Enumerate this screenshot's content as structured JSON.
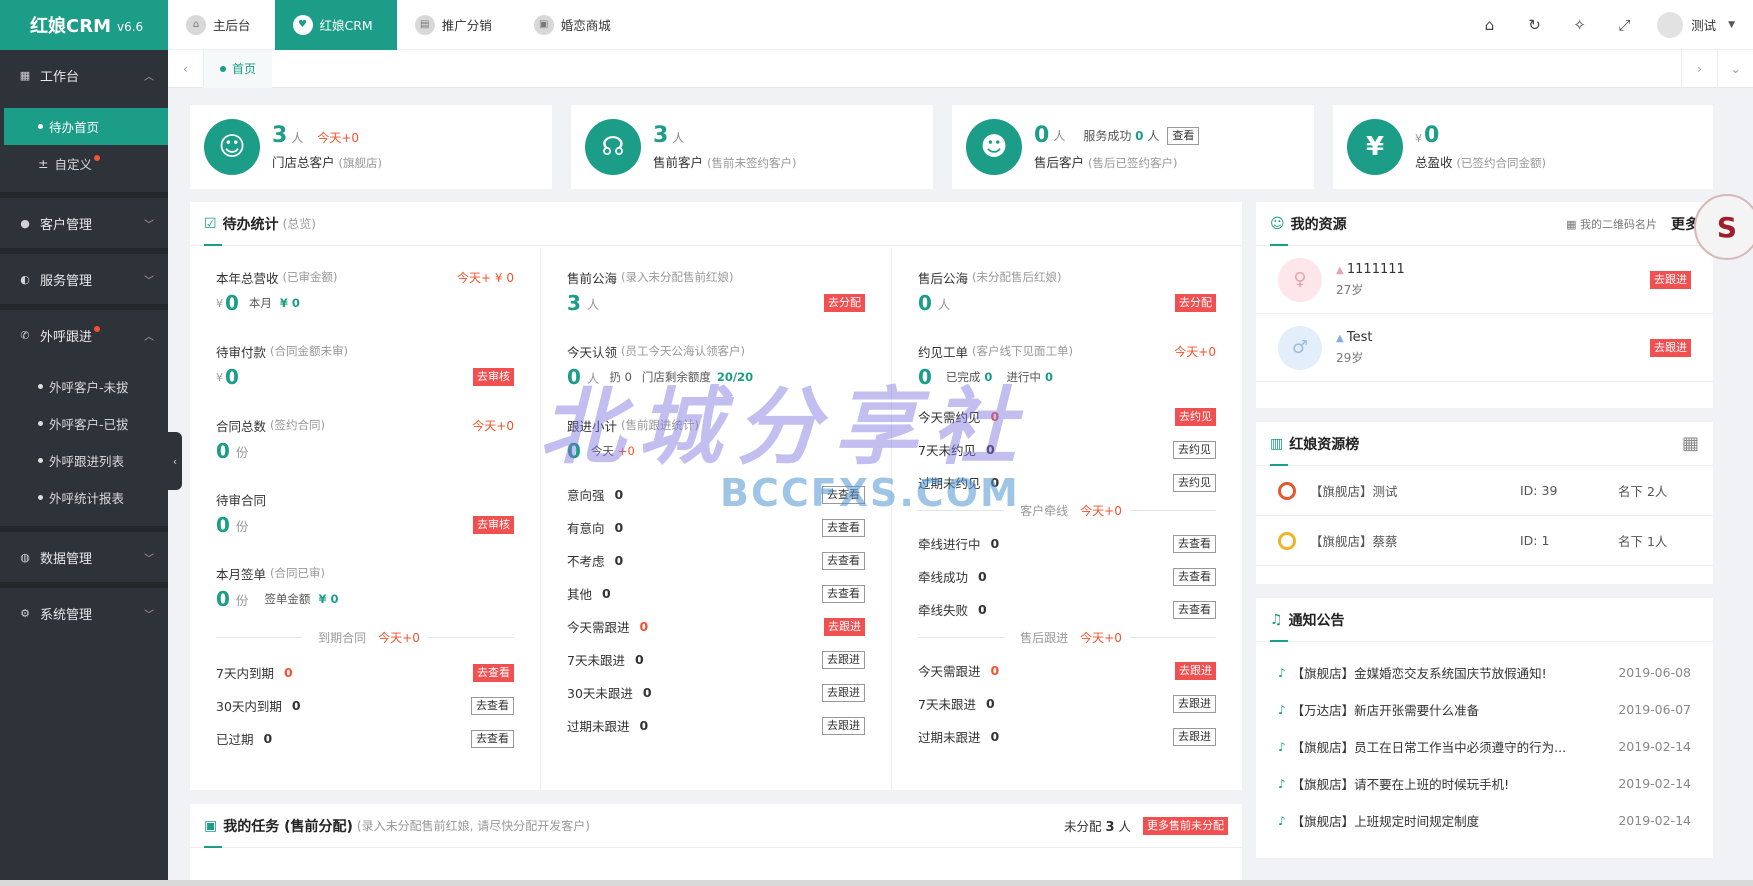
{
  "app": {
    "name": "红娘CRM",
    "version": "v6.6"
  },
  "sidebar": {
    "groups": [
      {
        "label": "工作台",
        "icon": "grid-icon",
        "expanded": true,
        "items": [
          {
            "label": "待办首页",
            "active": true
          },
          {
            "label": "自定义",
            "badge": true
          }
        ]
      },
      {
        "label": "客户管理",
        "icon": "user-icon",
        "expanded": false
      },
      {
        "label": "服务管理",
        "icon": "service-icon",
        "expanded": false
      },
      {
        "label": "外呼跟进",
        "icon": "phone-icon",
        "expanded": true,
        "badge": true,
        "items": [
          {
            "label": "外呼客户-未拔"
          },
          {
            "label": "外呼客户-已拔"
          },
          {
            "label": "外呼跟进列表"
          },
          {
            "label": "外呼统计报表"
          }
        ]
      },
      {
        "label": "数据管理",
        "icon": "data-icon",
        "expanded": false
      },
      {
        "label": "系统管理",
        "icon": "gear-icon",
        "expanded": false
      }
    ]
  },
  "topbar": {
    "tabs": [
      {
        "label": "主后台"
      },
      {
        "label": "红娘CRM",
        "active": true
      },
      {
        "label": "推广分销"
      },
      {
        "label": "婚恋商城"
      }
    ],
    "user": "测试"
  },
  "tabsbar": {
    "home": "首页"
  },
  "stats": [
    {
      "num": "3",
      "unit": "人",
      "today": "今天+0",
      "label": "门店总客户",
      "sub": "(旗舰店)",
      "icon": "customers-icon"
    },
    {
      "num": "3",
      "unit": "人",
      "label": "售前客户",
      "sub": "(售前未签约客户)",
      "icon": "headset-icon"
    },
    {
      "num": "0",
      "unit": "人",
      "svc_label": "服务成功",
      "svc_num": "0",
      "svc_unit": "人",
      "svc_btn": "查看",
      "label": "售后客户",
      "sub": "(售后已签约客户)",
      "icon": "agent-icon"
    },
    {
      "cur": "¥",
      "num": "0",
      "label": "总盈收",
      "sub": "(已签约合同金额)",
      "icon": "yen-icon"
    }
  ],
  "todo": {
    "title": "待办统计",
    "sub": "(总览)",
    "col1": {
      "annual_label": "本年总营收",
      "annual_sub": "(已审金额)",
      "annual_today": "今天+ ¥ 0",
      "annual_val": "0",
      "month_label": "本月",
      "month_val": "¥ 0",
      "pay_label": "待审付款",
      "pay_sub": "(合同金额未审)",
      "pay_val": "0",
      "pay_btn": "去审核",
      "contract_label": "合同总数",
      "contract_sub": "(签约合同)",
      "contract_today": "今天+0",
      "contract_val": "0",
      "contract_unit": "份",
      "pending_label": "待审合同",
      "pending_val": "0",
      "pending_unit": "份",
      "pending_btn": "去审核",
      "month_sign_label": "本月签单",
      "month_sign_sub": "(合同已审)",
      "month_sign_val": "0",
      "month_sign_unit": "份",
      "sign_amt_label": "签单金额",
      "sign_amt_val": "¥ 0",
      "expire_title": "到期合同",
      "expire_today": "今天+0",
      "expire_rows": [
        {
          "label": "7天内到期",
          "val": "0",
          "btn": "去查看",
          "hot": true
        },
        {
          "label": "30天内到期",
          "val": "0",
          "btn": "去查看"
        },
        {
          "label": "已过期",
          "val": "0",
          "btn": "去查看"
        }
      ]
    },
    "col2": {
      "pool_label": "售前公海",
      "pool_sub": "(录入未分配售前红娘)",
      "pool_val": "3",
      "pool_unit": "人",
      "pool_btn": "去分配",
      "claim_label": "今天认领",
      "claim_sub": "(员工今天公海认领客户)",
      "claim_val": "0",
      "claim_unit": "人",
      "claim_x": "扔 0",
      "claim_quota_label": "门店剩余额度",
      "claim_quota": "20/20",
      "follow_label": "跟进小计",
      "follow_sub": "(售前跟进统计)",
      "follow_val": "0",
      "follow_today": "今天",
      "follow_today_val": "+0",
      "rows": [
        {
          "label": "意向强",
          "val": "0",
          "btn": "去查看"
        },
        {
          "label": "有意向",
          "val": "0",
          "btn": "去查看"
        },
        {
          "label": "不考虑",
          "val": "0",
          "btn": "去查看"
        },
        {
          "label": "其他",
          "val": "0",
          "btn": "去查看"
        },
        {
          "label": "今天需跟进",
          "val": "0",
          "btn": "去跟进",
          "hot": true
        },
        {
          "label": "7天未跟进",
          "val": "0",
          "btn": "去跟进"
        },
        {
          "label": "30天未跟进",
          "val": "0",
          "btn": "去跟进"
        },
        {
          "label": "过期未跟进",
          "val": "0",
          "btn": "去跟进"
        }
      ]
    },
    "col3": {
      "pool_label": "售后公海",
      "pool_sub": "(未分配售后红娘)",
      "pool_val": "0",
      "pool_unit": "人",
      "pool_btn": "去分配",
      "meet_label": "约见工单",
      "meet_sub": "(客户线下见面工单)",
      "meet_today": "今天+0",
      "meet_val": "0",
      "done_label": "已完成",
      "done_val": "0",
      "going_label": "进行中",
      "going_val": "0",
      "meet_rows": [
        {
          "label": "今天需约见",
          "val": "0",
          "btn": "去约见",
          "hot": true
        },
        {
          "label": "7天未约见",
          "val": "0",
          "btn": "去约见"
        },
        {
          "label": "过期未约见",
          "val": "0",
          "btn": "去约见"
        }
      ],
      "line_title": "客户牵线",
      "line_today": "今天+0",
      "line_rows": [
        {
          "label": "牵线进行中",
          "val": "0",
          "btn": "去查看"
        },
        {
          "label": "牵线成功",
          "val": "0",
          "btn": "去查看"
        },
        {
          "label": "牵线失败",
          "val": "0",
          "btn": "去查看"
        }
      ],
      "after_title": "售后跟进",
      "after_today": "今天+0",
      "after_rows": [
        {
          "label": "今天需跟进",
          "val": "0",
          "btn": "去跟进",
          "hot": true
        },
        {
          "label": "7天未跟进",
          "val": "0",
          "btn": "去跟进"
        },
        {
          "label": "过期未跟进",
          "val": "0",
          "btn": "去跟进"
        }
      ]
    }
  },
  "tasks": {
    "title": "我的任务 (售前分配)",
    "sub": "(录入未分配售前红娘, 请尽快分配开发客户)",
    "unassigned_label": "未分配",
    "unassigned_val": "3",
    "unassigned_unit": "人",
    "btn": "更多售前未分配"
  },
  "resources": {
    "title": "我的资源",
    "qr_label": "我的二维码名片",
    "more": "更多",
    "items": [
      {
        "name": "1111111",
        "age": "27岁",
        "btn": "去跟进",
        "gender": "female"
      },
      {
        "name": "Test",
        "age": "29岁",
        "btn": "去跟进",
        "gender": "male"
      }
    ]
  },
  "rank": {
    "title": "红娘资源榜",
    "items": [
      {
        "name": "【旗舰店】测试",
        "id": "ID: 39",
        "count": "名下 2人"
      },
      {
        "name": "【旗舰店】蔡蔡",
        "id": "ID: 1",
        "count": "名下 1人"
      }
    ]
  },
  "notices": {
    "title": "通知公告",
    "items": [
      {
        "text": "【旗舰店】金媒婚恋交友系统国庆节放假通知!",
        "date": "2019-06-08"
      },
      {
        "text": "【万达店】新店开张需要什么准备",
        "date": "2019-06-07"
      },
      {
        "text": "【旗舰店】员工在日常工作当中必须遵守的行为...",
        "date": "2019-02-14"
      },
      {
        "text": "【旗舰店】请不要在上班的时候玩手机!",
        "date": "2019-02-14"
      },
      {
        "text": "【旗舰店】上班规定时间规定制度",
        "date": "2019-02-14"
      }
    ]
  },
  "watermark": {
    "main": "北城分享社",
    "sub": "BCCFXS.COM"
  },
  "badge": "S"
}
